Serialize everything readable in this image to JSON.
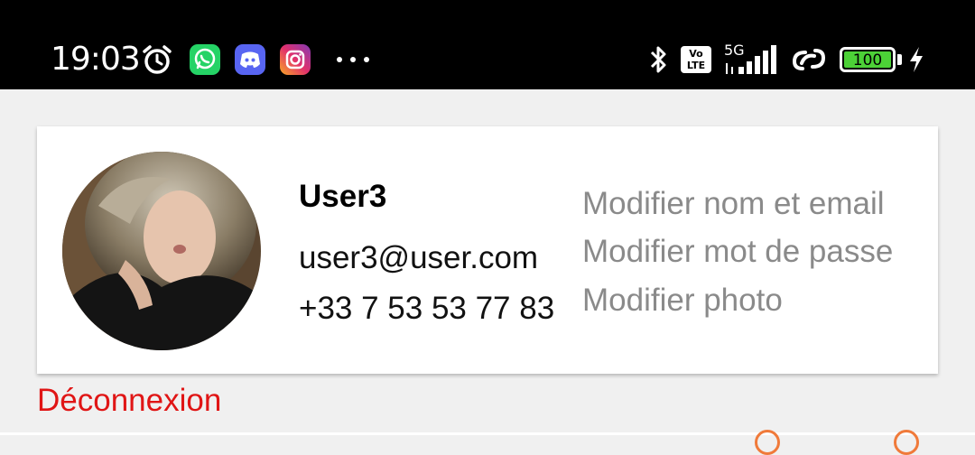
{
  "status_bar": {
    "time": "19:03",
    "battery_level": "100",
    "network_label": "5G",
    "volte_label_top": "Vo",
    "volte_label_bottom": "LTE",
    "icons": [
      "alarm-icon",
      "whatsapp-icon",
      "discord-icon",
      "instagram-icon",
      "more-icon",
      "bluetooth-icon",
      "volte-icon",
      "signal-icon",
      "hotspot-icon",
      "battery-icon",
      "charging-icon"
    ],
    "colors": {
      "whatsapp": "#25d366",
      "discord": "#5865f2",
      "instagram": "#e1306c",
      "battery": "#4cd137"
    }
  },
  "profile": {
    "name": "User3",
    "email": "user3@user.com",
    "phone": "+33 7 53 53 77 83"
  },
  "actions": {
    "edit_name_email": "Modifier nom et email",
    "edit_password": "Modifier mot de passe",
    "edit_photo": "Modifier photo"
  },
  "logout_label": "Déconnexion",
  "colors": {
    "logout": "#e01515",
    "action_text": "#8a8a8a",
    "background": "#f0f0f0"
  }
}
